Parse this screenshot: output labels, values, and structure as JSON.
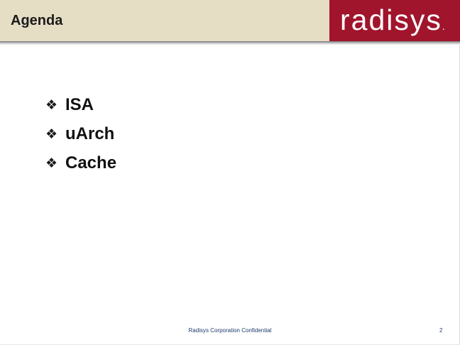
{
  "header": {
    "title": "Agenda",
    "logo_text": "radisys",
    "logo_dot": "."
  },
  "bullets": [
    {
      "glyph": "❖",
      "text": "ISA"
    },
    {
      "glyph": "❖",
      "text": "uArch"
    },
    {
      "glyph": "❖",
      "text": "Cache"
    }
  ],
  "footer": {
    "confidential": "Radisys Corporation Confidential",
    "page_number": "2"
  },
  "colors": {
    "header_background": "#e6ddc5",
    "logo_background": "#a0152c",
    "footer_text": "#1f3a6e"
  }
}
